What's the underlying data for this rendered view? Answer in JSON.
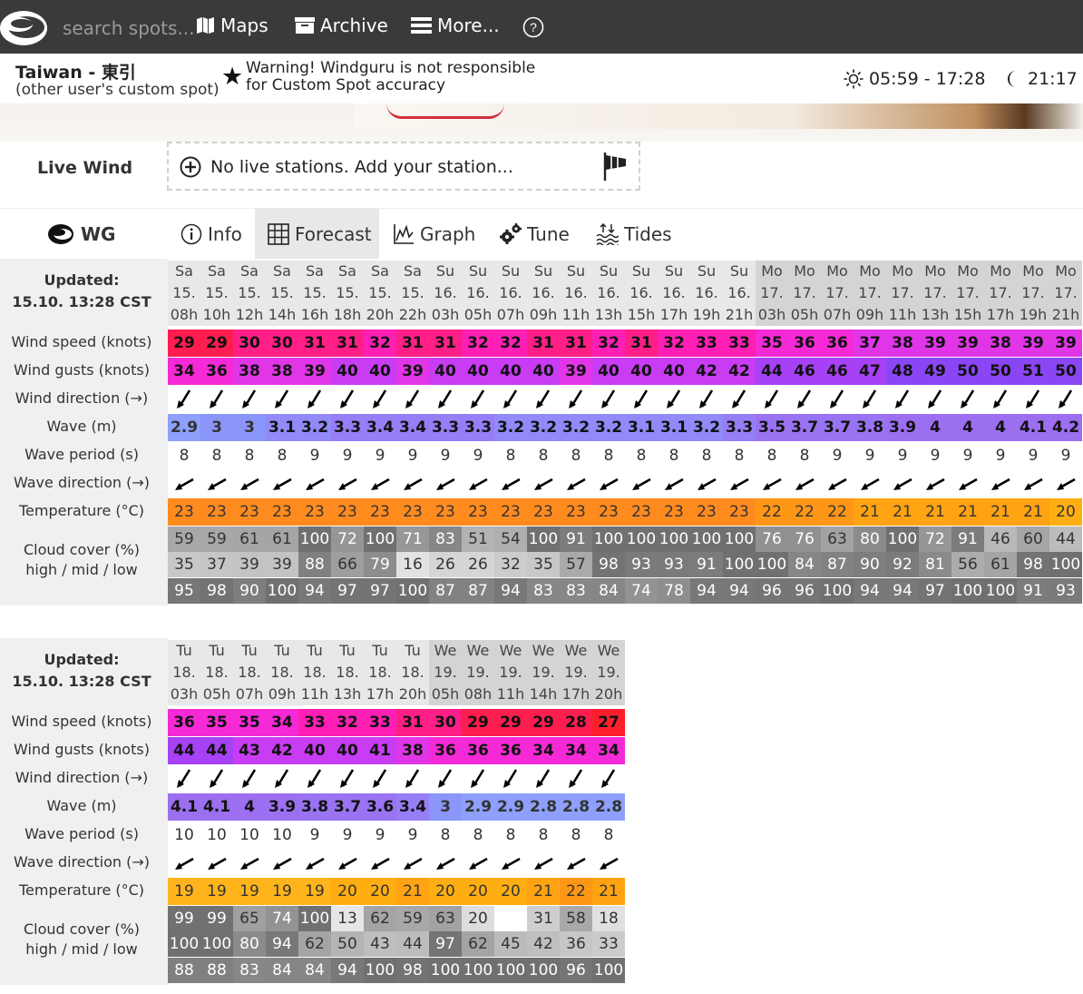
{
  "nav": {
    "search_placeholder": "search spots...",
    "maps": "Maps",
    "archive": "Archive",
    "more": "More...",
    "help": "?"
  },
  "spot": {
    "name": "Taiwan - 東引",
    "subtitle": "(other user's custom spot)",
    "warning_line1": "Warning! Windguru is not responsible",
    "warning_line2": "for Custom Spot accuracy",
    "sun": "05:59 - 17:28",
    "moon": "21:17 -"
  },
  "live_wind": {
    "label": "Live Wind",
    "text": "No live stations. Add your station..."
  },
  "tabs": [
    {
      "label": "WG",
      "icon": "windguru-logo-icon"
    },
    {
      "label": "Info",
      "icon": "info-icon"
    },
    {
      "label": "Forecast",
      "icon": "grid-icon",
      "active": true
    },
    {
      "label": "Graph",
      "icon": "chart-icon"
    },
    {
      "label": "Tune",
      "icon": "gears-icon"
    },
    {
      "label": "Tides",
      "icon": "tides-icon"
    }
  ],
  "labels": {
    "updated_title": "Updated:",
    "updated_time": "15.10. 13:28 CST",
    "wind_speed": "Wind speed (knots)",
    "wind_gusts": "Wind gusts (knots)",
    "wind_direction": "Wind direction (→)",
    "wave": "Wave (m)",
    "wave_period": "Wave period (s)",
    "wave_direction": "Wave direction (→)",
    "temperature": "Temperature (°C)",
    "cloud_cover": "Cloud cover (%)",
    "cloud_levels": "high / mid / low"
  },
  "grid1": {
    "days": [
      "Sa",
      "Sa",
      "Sa",
      "Sa",
      "Sa",
      "Sa",
      "Sa",
      "Sa",
      "Su",
      "Su",
      "Su",
      "Su",
      "Su",
      "Su",
      "Su",
      "Su",
      "Su",
      "Su",
      "Mo",
      "Mo",
      "Mo",
      "Mo",
      "Mo",
      "Mo",
      "Mo",
      "Mo",
      "Mo",
      "Mo"
    ],
    "dates": [
      "15.",
      "15.",
      "15.",
      "15.",
      "15.",
      "15.",
      "15.",
      "15.",
      "16.",
      "16.",
      "16.",
      "16.",
      "16.",
      "16.",
      "16.",
      "16.",
      "16.",
      "16.",
      "17.",
      "17.",
      "17.",
      "17.",
      "17.",
      "17.",
      "17.",
      "17.",
      "17.",
      "17."
    ],
    "hours": [
      "08h",
      "10h",
      "12h",
      "14h",
      "16h",
      "18h",
      "20h",
      "22h",
      "03h",
      "05h",
      "07h",
      "09h",
      "11h",
      "13h",
      "15h",
      "17h",
      "19h",
      "21h",
      "03h",
      "05h",
      "07h",
      "09h",
      "11h",
      "13h",
      "15h",
      "17h",
      "19h",
      "21h"
    ],
    "wind_speed": [
      "29",
      "29",
      "30",
      "30",
      "31",
      "31",
      "32",
      "31",
      "31",
      "32",
      "32",
      "31",
      "31",
      "32",
      "31",
      "32",
      "33",
      "33",
      "35",
      "36",
      "36",
      "37",
      "38",
      "39",
      "39",
      "38",
      "39",
      "39"
    ],
    "wind_gusts": [
      "34",
      "36",
      "38",
      "38",
      "39",
      "40",
      "40",
      "39",
      "40",
      "40",
      "40",
      "40",
      "39",
      "40",
      "40",
      "40",
      "42",
      "42",
      "44",
      "46",
      "46",
      "47",
      "48",
      "49",
      "50",
      "50",
      "51",
      "50"
    ],
    "wave": [
      "2.9",
      "3",
      "3",
      "3.1",
      "3.2",
      "3.3",
      "3.4",
      "3.4",
      "3.3",
      "3.3",
      "3.2",
      "3.2",
      "3.2",
      "3.2",
      "3.1",
      "3.1",
      "3.2",
      "3.3",
      "3.5",
      "3.7",
      "3.7",
      "3.8",
      "3.9",
      "4",
      "4",
      "4",
      "4.1",
      "4.2"
    ],
    "wave_period": [
      "8",
      "8",
      "8",
      "8",
      "9",
      "9",
      "9",
      "9",
      "9",
      "9",
      "8",
      "8",
      "8",
      "8",
      "8",
      "8",
      "8",
      "8",
      "8",
      "8",
      "9",
      "9",
      "9",
      "9",
      "9",
      "9",
      "9",
      "9"
    ],
    "temperature": [
      "23",
      "23",
      "23",
      "23",
      "23",
      "23",
      "23",
      "23",
      "23",
      "23",
      "23",
      "23",
      "23",
      "23",
      "23",
      "23",
      "23",
      "23",
      "22",
      "22",
      "22",
      "21",
      "21",
      "21",
      "21",
      "21",
      "21",
      "20"
    ],
    "cloud_high": [
      "59",
      "59",
      "61",
      "61",
      "100",
      "72",
      "100",
      "71",
      "83",
      "51",
      "54",
      "100",
      "91",
      "100",
      "100",
      "100",
      "100",
      "100",
      "76",
      "76",
      "63",
      "80",
      "100",
      "72",
      "91",
      "46",
      "60",
      "44"
    ],
    "cloud_mid": [
      "35",
      "37",
      "39",
      "39",
      "88",
      "66",
      "79",
      "16",
      "26",
      "26",
      "32",
      "35",
      "57",
      "98",
      "93",
      "93",
      "91",
      "100",
      "100",
      "84",
      "87",
      "90",
      "92",
      "81",
      "56",
      "61",
      "98",
      "100"
    ],
    "cloud_low": [
      "95",
      "98",
      "90",
      "100",
      "94",
      "97",
      "97",
      "100",
      "87",
      "87",
      "94",
      "83",
      "83",
      "84",
      "74",
      "78",
      "94",
      "94",
      "96",
      "96",
      "100",
      "94",
      "94",
      "97",
      "100",
      "100",
      "91",
      "93"
    ]
  },
  "grid2": {
    "days": [
      "Tu",
      "Tu",
      "Tu",
      "Tu",
      "Tu",
      "Tu",
      "Tu",
      "Tu",
      "We",
      "We",
      "We",
      "We",
      "We",
      "We"
    ],
    "dates": [
      "18.",
      "18.",
      "18.",
      "18.",
      "18.",
      "18.",
      "18.",
      "18.",
      "19.",
      "19.",
      "19.",
      "19.",
      "19.",
      "19."
    ],
    "hours": [
      "03h",
      "05h",
      "07h",
      "09h",
      "11h",
      "13h",
      "17h",
      "20h",
      "05h",
      "08h",
      "11h",
      "14h",
      "17h",
      "20h"
    ],
    "wind_speed": [
      "36",
      "35",
      "35",
      "34",
      "33",
      "32",
      "33",
      "31",
      "30",
      "29",
      "29",
      "29",
      "28",
      "27"
    ],
    "wind_gusts": [
      "44",
      "44",
      "43",
      "42",
      "40",
      "40",
      "41",
      "38",
      "36",
      "36",
      "36",
      "34",
      "34",
      "34"
    ],
    "wave": [
      "4.1",
      "4.1",
      "4",
      "3.9",
      "3.8",
      "3.7",
      "3.6",
      "3.4",
      "3",
      "2.9",
      "2.9",
      "2.8",
      "2.8",
      "2.8"
    ],
    "wave_period": [
      "10",
      "10",
      "10",
      "10",
      "9",
      "9",
      "9",
      "9",
      "8",
      "8",
      "8",
      "8",
      "8",
      "8"
    ],
    "temperature": [
      "19",
      "19",
      "19",
      "19",
      "19",
      "20",
      "20",
      "21",
      "20",
      "20",
      "20",
      "21",
      "22",
      "21"
    ],
    "cloud_high": [
      "99",
      "99",
      "65",
      "74",
      "100",
      "13",
      "62",
      "59",
      "63",
      "20",
      "",
      "31",
      "58",
      "18"
    ],
    "cloud_mid": [
      "100",
      "100",
      "80",
      "94",
      "62",
      "50",
      "43",
      "44",
      "97",
      "62",
      "45",
      "42",
      "36",
      "33"
    ],
    "cloud_low": [
      "88",
      "88",
      "83",
      "84",
      "84",
      "94",
      "100",
      "98",
      "100",
      "100",
      "100",
      "100",
      "96",
      "100"
    ]
  },
  "colors": {
    "nav_bg": "#3a3a3a",
    "label_bg": "#f0f0f0"
  }
}
